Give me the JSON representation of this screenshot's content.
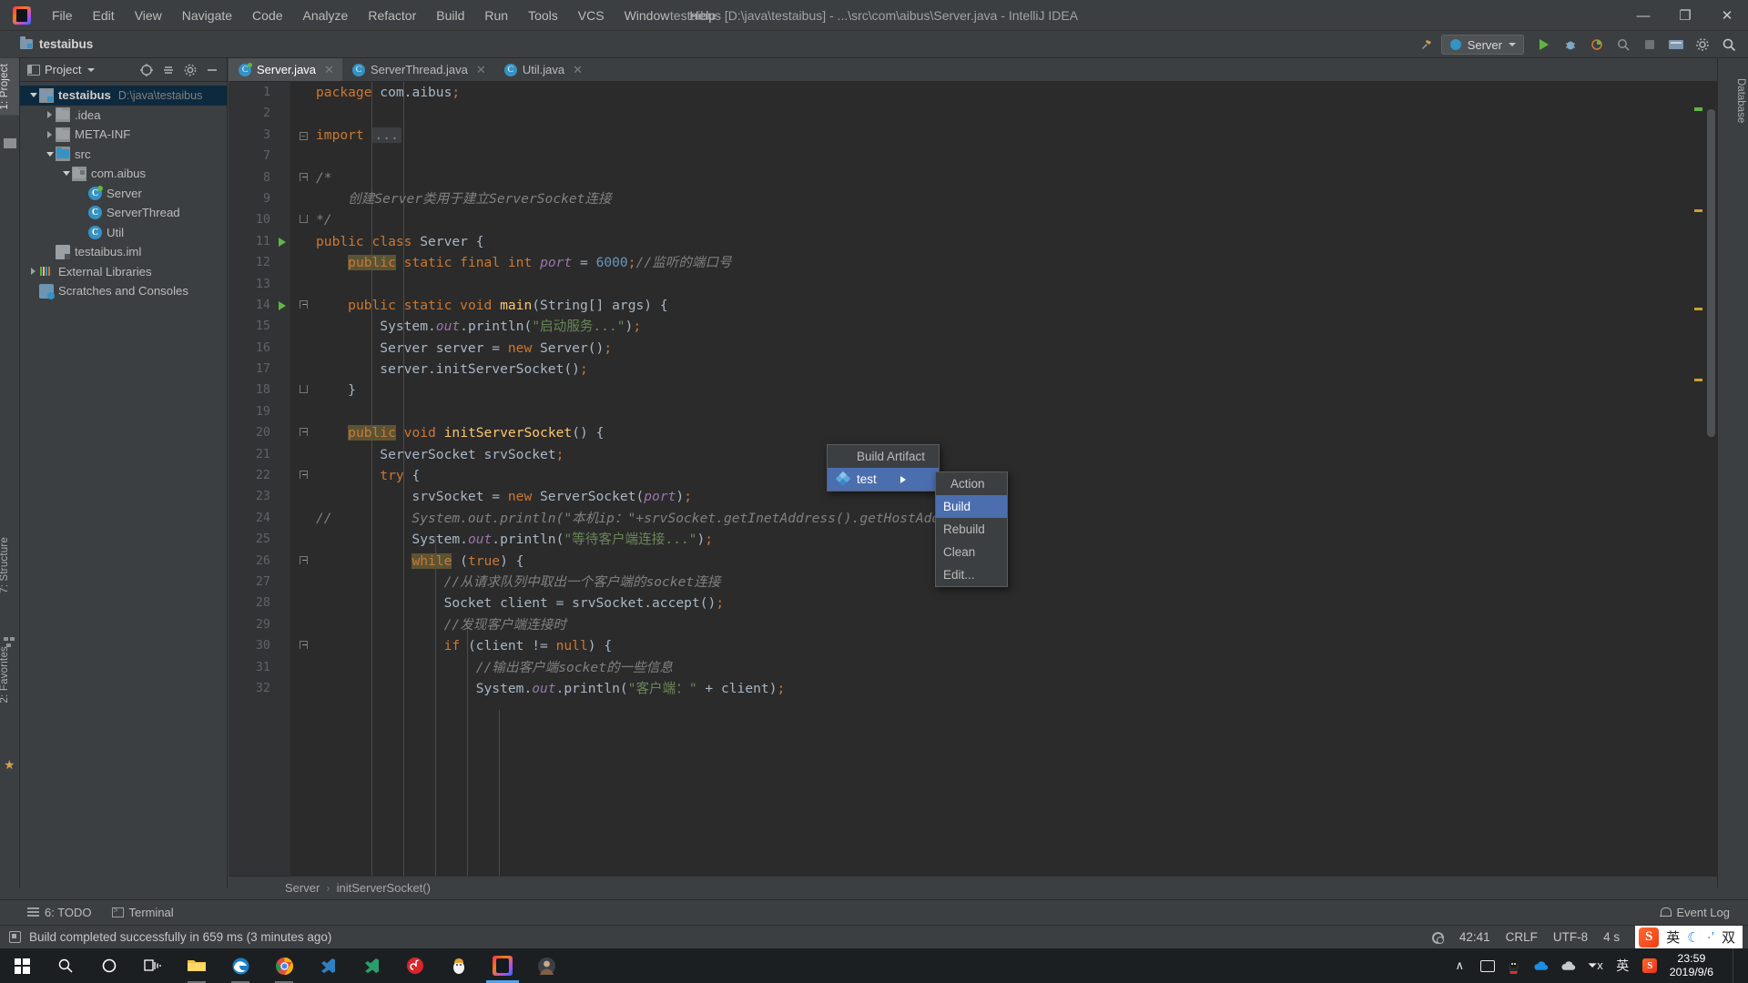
{
  "window": {
    "title": "testaibus [D:\\java\\testaibus] - ...\\src\\com\\aibus\\Server.java - IntelliJ IDEA",
    "minimize": "—",
    "maximize": "❐",
    "close": "✕"
  },
  "menubar": {
    "items": [
      {
        "label": "File"
      },
      {
        "label": "Edit"
      },
      {
        "label": "View"
      },
      {
        "label": "Navigate"
      },
      {
        "label": "Code"
      },
      {
        "label": "Analyze"
      },
      {
        "label": "Refactor"
      },
      {
        "label": "Build"
      },
      {
        "label": "Run"
      },
      {
        "label": "Tools"
      },
      {
        "label": "VCS"
      },
      {
        "label": "Window"
      },
      {
        "label": "Help"
      }
    ]
  },
  "navbar": {
    "project_label": "testaibus",
    "run_config": "Server"
  },
  "left_strip": {
    "project_tab": "1: Project",
    "structure_tab": "7: Structure",
    "favorites_tab": "2: Favorites"
  },
  "right_strip": {
    "database_tab": "Database"
  },
  "project_pane": {
    "title": "Project",
    "tree": [
      {
        "depth": 0,
        "label": "testaibus",
        "path": "D:\\java\\testaibus",
        "icon": "project-folder-icon",
        "twisty": "down",
        "bold": true,
        "selected": true
      },
      {
        "depth": 1,
        "label": ".idea",
        "path": "",
        "icon": "folder-icon",
        "twisty": "right",
        "bold": false,
        "selected": false
      },
      {
        "depth": 1,
        "label": "META-INF",
        "path": "",
        "icon": "folder-icon",
        "twisty": "right",
        "bold": false,
        "selected": false
      },
      {
        "depth": 1,
        "label": "src",
        "path": "",
        "icon": "source-folder-icon",
        "twisty": "down",
        "bold": false,
        "selected": false
      },
      {
        "depth": 2,
        "label": "com.aibus",
        "path": "",
        "icon": "package-icon",
        "twisty": "down",
        "bold": false,
        "selected": false
      },
      {
        "depth": 3,
        "label": "Server",
        "path": "",
        "icon": "java-class-runnable-icon",
        "twisty": "",
        "bold": false,
        "selected": false
      },
      {
        "depth": 3,
        "label": "ServerThread",
        "path": "",
        "icon": "java-class-icon",
        "twisty": "",
        "bold": false,
        "selected": false
      },
      {
        "depth": 3,
        "label": "Util",
        "path": "",
        "icon": "java-class-icon",
        "twisty": "",
        "bold": false,
        "selected": false
      },
      {
        "depth": 1,
        "label": "testaibus.iml",
        "path": "",
        "icon": "iml-file-icon",
        "twisty": "",
        "bold": false,
        "selected": false
      },
      {
        "depth": 0,
        "label": "External Libraries",
        "path": "",
        "icon": "libraries-icon",
        "twisty": "right",
        "bold": false,
        "selected": false
      },
      {
        "depth": 0,
        "label": "Scratches and Consoles",
        "path": "",
        "icon": "scratches-icon",
        "twisty": "",
        "bold": false,
        "selected": false
      }
    ]
  },
  "editor": {
    "tabs": [
      {
        "label": "Server.java",
        "active": true,
        "runnable": true
      },
      {
        "label": "ServerThread.java",
        "active": false,
        "runnable": false
      },
      {
        "label": "Util.java",
        "active": false,
        "runnable": false
      }
    ],
    "breadcrumb": [
      "Server",
      "initServerSocket()"
    ],
    "breadcrumb_separator": "›",
    "lines": [
      {
        "num": "1",
        "gutter": "",
        "fold": "",
        "html": "<span class=\"kw\">package</span> com.aibus<span class=\"semi\">;</span>"
      },
      {
        "num": "2",
        "gutter": "",
        "fold": "",
        "html": ""
      },
      {
        "num": "3",
        "gutter": "",
        "fold": "box",
        "html": "<span class=\"kw\">import</span> <span class=\"placeholder\">...</span>"
      },
      {
        "num": "7",
        "gutter": "",
        "fold": "",
        "html": ""
      },
      {
        "num": "8",
        "gutter": "",
        "fold": "top",
        "html": "<span class=\"cmt\">/*</span>"
      },
      {
        "num": "9",
        "gutter": "",
        "fold": "",
        "html": "    <span class=\"cmt\">创建Server类用于建立ServerSocket连接</span>"
      },
      {
        "num": "10",
        "gutter": "",
        "fold": "end",
        "html": "<span class=\"cmt\">*/</span>"
      },
      {
        "num": "11",
        "gutter": "run",
        "fold": "",
        "html": "<span class=\"kw\">public class</span> Server {"
      },
      {
        "num": "12",
        "gutter": "",
        "fold": "",
        "html": "    <span class=\"kwhl\">public</span> <span class=\"kw\">static final int</span> <span class=\"sfld\">port</span> = <span class=\"num\">6000</span><span class=\"semi\">;</span><span class=\"cmt\">//监听的端口号</span>"
      },
      {
        "num": "13",
        "gutter": "",
        "fold": "",
        "html": ""
      },
      {
        "num": "14",
        "gutter": "run",
        "fold": "top",
        "html": "    <span class=\"kw\">public static void</span> <span class=\"mth\">main</span>(String[] args) {"
      },
      {
        "num": "15",
        "gutter": "",
        "fold": "",
        "html": "        System.<span class=\"fld\">out</span>.println(<span class=\"str\">\"启动服务...\"</span>)<span class=\"semi\">;</span>"
      },
      {
        "num": "16",
        "gutter": "",
        "fold": "",
        "html": "        Server server = <span class=\"kw\">new</span> Server()<span class=\"semi\">;</span>"
      },
      {
        "num": "17",
        "gutter": "",
        "fold": "",
        "html": "        server.initServerSocket()<span class=\"semi\">;</span>"
      },
      {
        "num": "18",
        "gutter": "",
        "fold": "end",
        "html": "    }"
      },
      {
        "num": "19",
        "gutter": "",
        "fold": "",
        "html": ""
      },
      {
        "num": "20",
        "gutter": "",
        "fold": "top",
        "html": "    <span class=\"kwhl\">public</span> <span class=\"kw\">void</span> <span class=\"mth\">initServerSocket</span>() {"
      },
      {
        "num": "21",
        "gutter": "",
        "fold": "",
        "html": "        ServerSocket srvSocket<span class=\"semi\">;</span>"
      },
      {
        "num": "22",
        "gutter": "",
        "fold": "top",
        "html": "        <span class=\"kw\">try</span> {"
      },
      {
        "num": "23",
        "gutter": "",
        "fold": "",
        "html": "            srvSocket = <span class=\"kw\">new</span> ServerSocket(<span class=\"sfld\">port</span>)<span class=\"semi\">;</span>"
      },
      {
        "num": "24",
        "gutter": "",
        "fold": "",
        "html": "<span class=\"cmt\">//          System.out.println(\"本机ip：\"+srvSocket.<span class=\"typo\">getInetAddress</span>().getHostAddress());</span>"
      },
      {
        "num": "25",
        "gutter": "",
        "fold": "",
        "html": "            System.<span class=\"fld\">out</span>.println(<span class=\"str\">\"等待客户端连接...\"</span>)<span class=\"semi\">;</span>"
      },
      {
        "num": "26",
        "gutter": "",
        "fold": "top",
        "html": "            <span class=\"kwhl\">while</span> (<span class=\"kw\">true</span>) {"
      },
      {
        "num": "27",
        "gutter": "",
        "fold": "",
        "html": "                <span class=\"cmt\">//从请求队列中取出一个客户端的socket连接</span>"
      },
      {
        "num": "28",
        "gutter": "",
        "fold": "",
        "html": "                Socket client = srvSocket.accept()<span class=\"semi\">;</span>"
      },
      {
        "num": "29",
        "gutter": "",
        "fold": "",
        "html": "                <span class=\"cmt\">//发现客户端连接时</span>"
      },
      {
        "num": "30",
        "gutter": "",
        "fold": "top",
        "html": "                <span class=\"kw\">if</span> (client != <span class=\"kw\">null</span>) {"
      },
      {
        "num": "31",
        "gutter": "",
        "fold": "",
        "html": "                    <span class=\"cmt\">//输出客户端socket的一些信息</span>"
      },
      {
        "num": "32",
        "gutter": "",
        "fold": "",
        "html": "                    System.<span class=\"fld\">out</span>.println(<span class=\"str\">\"客户端：\"</span> + client)<span class=\"semi\">;</span>"
      }
    ]
  },
  "context_menu": {
    "items": [
      {
        "label": "Build Artifact",
        "selected": false,
        "icon": "",
        "submenu": false
      },
      {
        "label": "test",
        "selected": true,
        "icon": "artifact-icon",
        "submenu": true
      }
    ],
    "submenu": {
      "items": [
        {
          "label": "Action",
          "selected": false,
          "header": true
        },
        {
          "label": "Build",
          "selected": true,
          "header": false
        },
        {
          "label": "Rebuild",
          "selected": false,
          "header": false
        },
        {
          "label": "Clean",
          "selected": false,
          "header": false
        },
        {
          "label": "Edit...",
          "selected": false,
          "header": false
        }
      ]
    }
  },
  "bottom_bar": {
    "todo": "6: TODO",
    "terminal": "Terminal",
    "event_log": "Event Log"
  },
  "status_bar": {
    "message": "Build completed successfully in 659 ms (3 minutes ago)",
    "caret_position": "42:41",
    "line_separator": "CRLF",
    "encoding": "UTF-8",
    "indent": "4 s",
    "ime_lang": "英",
    "ime_moon": "☾",
    "ime_dots": "·’",
    "ime_double": "双",
    "sogou": "S"
  },
  "taskbar": {
    "clock_time": "23:59",
    "clock_date": "2019/9/6",
    "tray_lang": "英",
    "tray_sogou": "S",
    "tray_mute": "⏷x",
    "tray_chevron": "∧",
    "apps": [
      {
        "name": "search-icon"
      },
      {
        "name": "cortana-icon"
      },
      {
        "name": "task-view-icon"
      },
      {
        "name": "file-explorer-icon"
      },
      {
        "name": "edge-icon"
      },
      {
        "name": "chrome-icon"
      },
      {
        "name": "vscode-icon"
      },
      {
        "name": "vscode-insiders-icon"
      },
      {
        "name": "netease-music-icon"
      },
      {
        "name": "tomcat-icon"
      },
      {
        "name": "intellij-idea-icon"
      },
      {
        "name": "photo-app-icon"
      }
    ]
  }
}
